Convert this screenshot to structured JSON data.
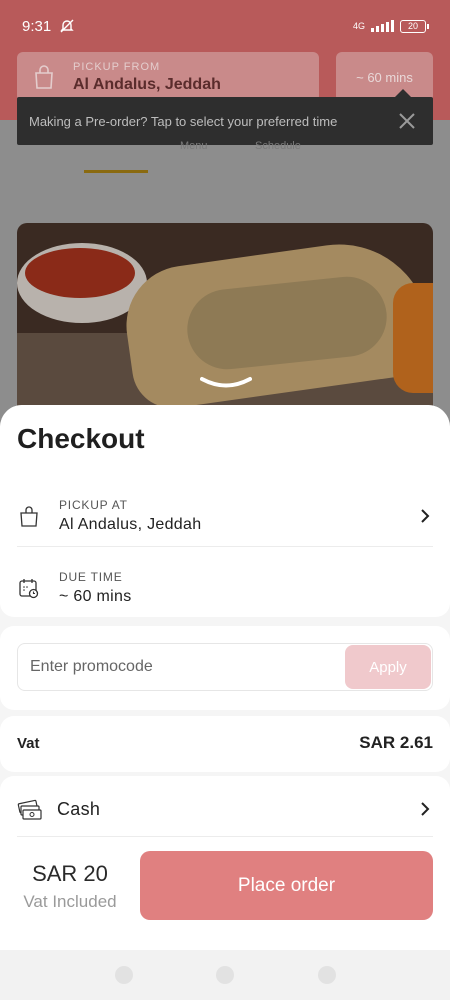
{
  "status_bar": {
    "time": "9:31",
    "network": "4G",
    "battery": "20"
  },
  "background": {
    "pickup_from_label": "PICKUP FROM",
    "pickup_from_value": "Al Andalus, Jeddah",
    "time_estimate": "~ 60 mins",
    "tooltip_text": "Making a Pre-order? Tap to select your preferred time",
    "tab_text_left": "Menu",
    "tab_text_right": "Schedule"
  },
  "checkout": {
    "title": "Checkout",
    "pickup_at_label": "PICKUP AT",
    "pickup_at_value": "Al Andalus, Jeddah",
    "due_time_label": "DUE TIME",
    "due_time_value": "~ 60 mins",
    "promo_placeholder": "Enter promocode",
    "apply_label": "Apply",
    "vat_label": "Vat",
    "vat_value": "SAR 2.61",
    "payment_method": "Cash",
    "total_amount": "SAR 20",
    "total_note": "Vat Included",
    "place_order_label": "Place order"
  },
  "colors": {
    "brand": "#e08080",
    "apply_disabled": "#f0c9cc",
    "header_dimmed": "#b85a5a"
  },
  "icons": [
    "mute-icon",
    "signal-icon",
    "battery-icon",
    "shopping-bag-icon",
    "close-icon",
    "chevron-down-icon",
    "calendar-clock-icon",
    "chevron-right-icon",
    "cash-icon"
  ]
}
